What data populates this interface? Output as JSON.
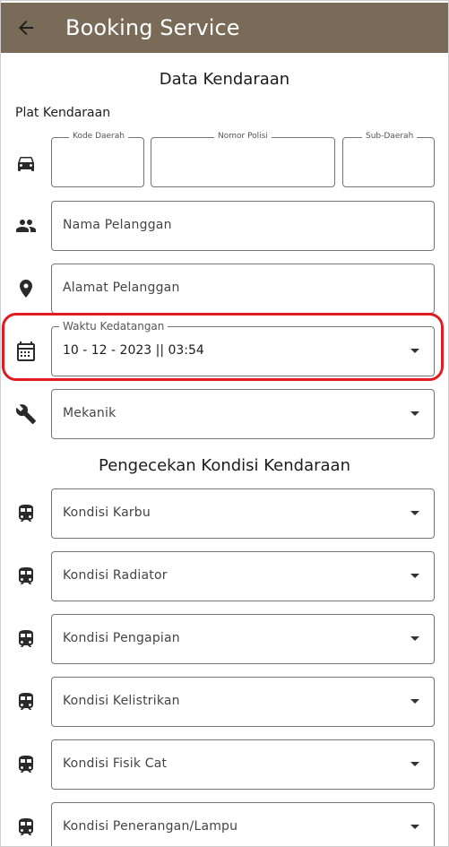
{
  "appbar": {
    "title": "Booking Service",
    "back_icon": "arrow-back-icon"
  },
  "vehicle_section": {
    "title": "Data Kendaraan",
    "plate_label": "Plat Kendaraan",
    "plate_fields": {
      "kode_daerah": "Kode Daerah",
      "nomor_polisi": "Nomor Polisi",
      "sub_daerah": "Sub-Daerah"
    },
    "customer_name_placeholder": "Nama Pelanggan",
    "customer_address_placeholder": "Alamat Pelanggan",
    "arrival_label": "Waktu Kedatangan",
    "arrival_value": "10 - 12 - 2023 || 03:54",
    "mechanic_placeholder": "Mekanik"
  },
  "condition_section": {
    "title": "Pengecekan Kondisi Kendaraan",
    "items": [
      {
        "label": "Kondisi Karbu"
      },
      {
        "label": "Kondisi Radiator"
      },
      {
        "label": "Kondisi Pengapian"
      },
      {
        "label": "Kondisi Kelistrikan"
      },
      {
        "label": "Kondisi Fisik Cat"
      },
      {
        "label": "Kondisi Penerangan/Lampu"
      }
    ]
  },
  "colors": {
    "appbar": "#7a6b58",
    "highlight": "#e11b22",
    "border": "#757575"
  }
}
